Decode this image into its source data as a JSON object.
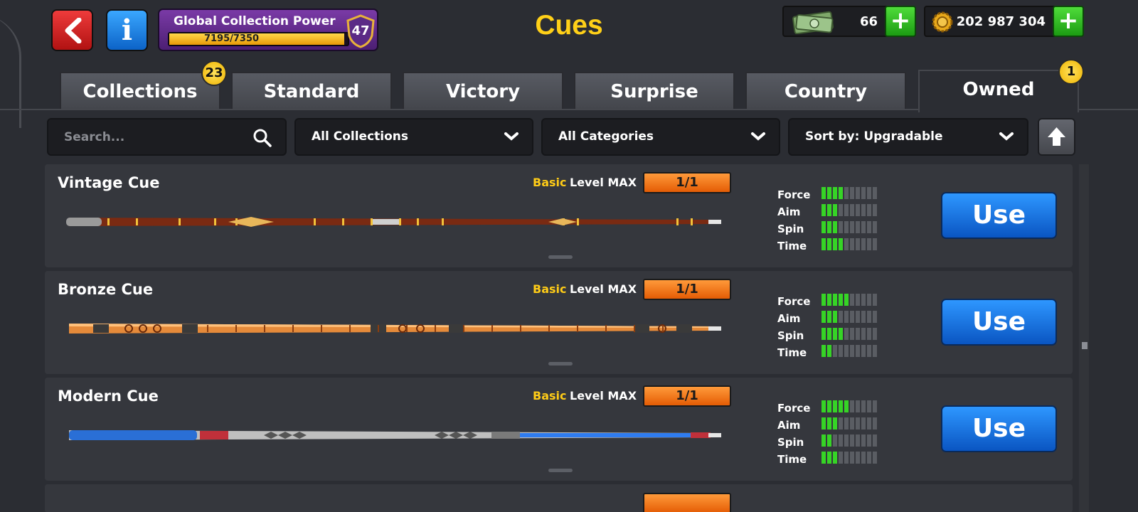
{
  "header": {
    "title": "Cues",
    "back_icon": "chevron-left-icon",
    "info_label": "i",
    "power": {
      "label": "Global Collection Power",
      "value_text": "7195/7350",
      "progress": 0.979,
      "level": "47"
    },
    "cash": {
      "value": "66",
      "icon": "cash-icon",
      "plus": "+"
    },
    "coins": {
      "value": "202 987 304",
      "icon": "coin-icon",
      "plus": "+"
    }
  },
  "tabs": [
    {
      "label": "Collections",
      "badge": "23"
    },
    {
      "label": "Standard"
    },
    {
      "label": "Victory"
    },
    {
      "label": "Surprise"
    },
    {
      "label": "Country"
    },
    {
      "label": "Owned",
      "badge": "1",
      "active": true
    }
  ],
  "filters": {
    "search_placeholder": "Search...",
    "collections": "All Collections",
    "categories": "All Categories",
    "sort": "Sort by: Upgradable"
  },
  "cues": [
    {
      "name": "Vintage Cue",
      "rarity": "Basic",
      "level_label": "Level MAX",
      "level_value": "1/1",
      "stats": {
        "force": 4,
        "aim": 3,
        "spin": 3,
        "time": 4
      },
      "use_label": "Use"
    },
    {
      "name": "Bronze Cue",
      "rarity": "Basic",
      "level_label": "Level MAX",
      "level_value": "1/1",
      "stats": {
        "force": 5,
        "aim": 3,
        "spin": 4,
        "time": 2
      },
      "use_label": "Use"
    },
    {
      "name": "Modern Cue",
      "rarity": "Basic",
      "level_label": "Level MAX",
      "level_value": "1/1",
      "stats": {
        "force": 5,
        "aim": 3,
        "spin": 2,
        "time": 3
      },
      "use_label": "Use"
    }
  ],
  "stat_labels": {
    "force": "Force",
    "aim": "Aim",
    "spin": "Spin",
    "time": "Time"
  },
  "stat_max": 10,
  "colors": {
    "accent_yellow": "#ffd018",
    "use_blue": "#1e7be8",
    "stat_green": "#36d426",
    "level_orange": "#f57a1e"
  }
}
